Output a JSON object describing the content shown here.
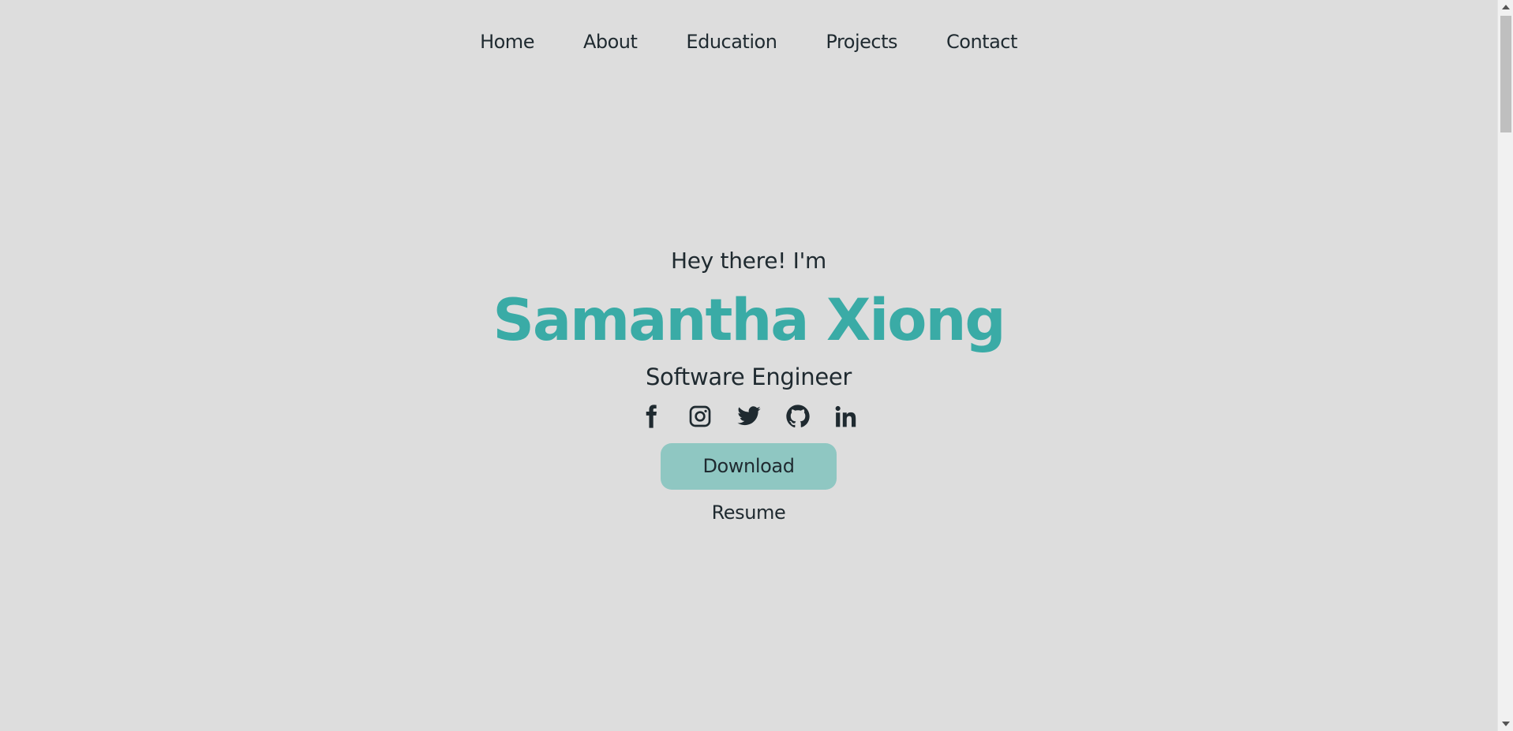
{
  "nav": {
    "items": [
      {
        "label": "Home"
      },
      {
        "label": "About"
      },
      {
        "label": "Education"
      },
      {
        "label": "Projects"
      },
      {
        "label": "Contact"
      }
    ]
  },
  "hero": {
    "greeting": "Hey there! I'm",
    "name": "Samantha Xiong",
    "role": "Software Engineer",
    "socials": [
      {
        "icon": "facebook-icon"
      },
      {
        "icon": "instagram-icon"
      },
      {
        "icon": "twitter-icon"
      },
      {
        "icon": "github-icon"
      },
      {
        "icon": "linkedin-icon"
      }
    ],
    "button_label": "Download Resume"
  },
  "colors": {
    "background": "#dddddd",
    "accent": "#3aaba6",
    "button": "#8fc7c2",
    "text": "#1f2a30"
  }
}
